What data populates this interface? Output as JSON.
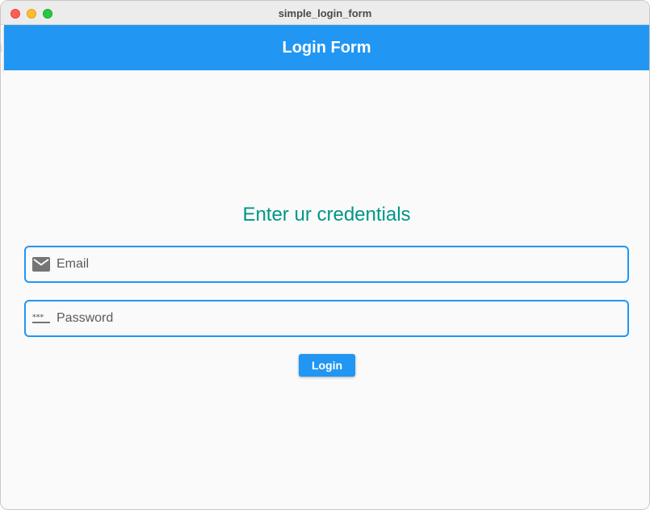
{
  "window": {
    "title": "simple_login_form"
  },
  "appbar": {
    "title": "Login Form",
    "color": "#2196f3"
  },
  "form": {
    "heading": "Enter ur credentials",
    "heading_color": "#009688",
    "email": {
      "icon": "mail-icon",
      "placeholder": "Email",
      "value": ""
    },
    "password": {
      "icon": "password-icon",
      "placeholder": "Password",
      "value": ""
    },
    "login_label": "Login"
  }
}
